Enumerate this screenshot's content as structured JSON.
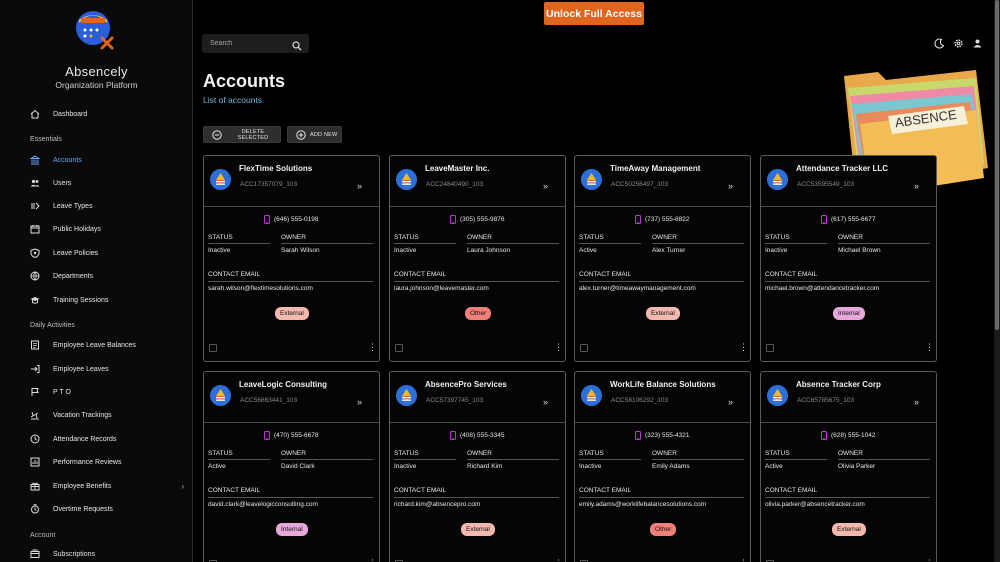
{
  "app": {
    "name": "Absencely",
    "subtitle": "Organization Platform"
  },
  "topbar": {
    "unlock_label": "Unlock Full Access",
    "search_placeholder": "Search",
    "icons": [
      "moon-icon",
      "gear-icon",
      "user-icon"
    ]
  },
  "sidebar": {
    "dashboard": "Dashboard",
    "sections": [
      {
        "label": "Essentials",
        "items": [
          {
            "label": "Accounts",
            "icon": "bank-icon",
            "active": true
          },
          {
            "label": "Users",
            "icon": "users-icon"
          },
          {
            "label": "Leave Types",
            "icon": "leave-types-icon"
          },
          {
            "label": "Public Holidays",
            "icon": "calendar-icon"
          },
          {
            "label": "Leave Policies",
            "icon": "policy-icon"
          },
          {
            "label": "Departments",
            "icon": "departments-icon"
          },
          {
            "label": "Training Sessions",
            "icon": "training-icon"
          }
        ]
      },
      {
        "label": "Daily Activities",
        "items": [
          {
            "label": "Employee Leave Balances",
            "icon": "balance-icon"
          },
          {
            "label": "Employee Leaves",
            "icon": "leaves-icon"
          },
          {
            "label": "P T O",
            "icon": "pto-icon"
          },
          {
            "label": "Vacation Trackings",
            "icon": "vacation-icon"
          },
          {
            "label": "Attendance Records",
            "icon": "clock-icon"
          },
          {
            "label": "Performance Reviews",
            "icon": "review-icon"
          },
          {
            "label": "Employee Benefits",
            "icon": "gift-icon"
          },
          {
            "label": "Overtime Requests",
            "icon": "overtime-icon"
          }
        ]
      },
      {
        "label": "Account",
        "items": [
          {
            "label": "Subscriptions",
            "icon": "subscription-icon"
          }
        ]
      }
    ]
  },
  "page": {
    "title": "Accounts",
    "subtitle": "List of accounts",
    "delete_label": "DELETE SELECTED",
    "add_label": "ADD NEW"
  },
  "illustration": {
    "label": "ABSENCE"
  },
  "card_labels": {
    "status": "STATUS",
    "owner": "OWNER",
    "contact_email": "CONTACT EMAIL"
  },
  "badge_colors": {
    "External": "#f4b9ae",
    "Other": "#f07f7a",
    "Internal": "#e7a6dc"
  },
  "accounts": [
    {
      "name": "FlexTime Solutions",
      "id": "ACC17357079_103",
      "phone": "(646) 555-0198",
      "status": "Inactive",
      "owner": "Sarah Wilson",
      "email": "sarah.wilson@flextimesolutions.com",
      "type": "External"
    },
    {
      "name": "LeaveMaster Inc.",
      "id": "ACC24840490_103",
      "phone": "(305) 555-9876",
      "status": "Inactive",
      "owner": "Laura Johnson",
      "email": "laura.johnson@leavemaster.com",
      "type": "Other"
    },
    {
      "name": "TimeAway Management",
      "id": "ACC50256497_103",
      "phone": "(737) 555-8822",
      "status": "Active",
      "owner": "Alex Turner",
      "email": "alex.turner@timeawaymanagement.com",
      "type": "External"
    },
    {
      "name": "Attendance Tracker LLC",
      "id": "ACC53595549_103",
      "phone": "(617) 555-6677",
      "status": "Inactive",
      "owner": "Michael Brown",
      "email": "michael.brown@attendancetracker.com",
      "type": "Internal"
    },
    {
      "name": "LeaveLogic Consulting",
      "id": "ACC56863441_103",
      "phone": "(470) 555-6678",
      "status": "Active",
      "owner": "David Clark",
      "email": "david.clark@leavelogicconsulting.com",
      "type": "Internal"
    },
    {
      "name": "AbsencePro Services",
      "id": "ACC57397745_103",
      "phone": "(408) 555-3345",
      "status": "Inactive",
      "owner": "Richard Kim",
      "email": "richard.kim@absencepro.com",
      "type": "External"
    },
    {
      "name": "WorkLife Balance Solutions",
      "id": "ACC58106292_103",
      "phone": "(323) 555-4321",
      "status": "Inactive",
      "owner": "Emily Adams",
      "email": "emily.adams@worklifebalancesolutions.com",
      "type": "Other"
    },
    {
      "name": "Absence Tracker Corp",
      "id": "ACC65785675_103",
      "phone": "(628) 555-1042",
      "status": "Active",
      "owner": "Olivia Parker",
      "email": "olivia.parker@absencetracker.com",
      "type": "External"
    }
  ]
}
